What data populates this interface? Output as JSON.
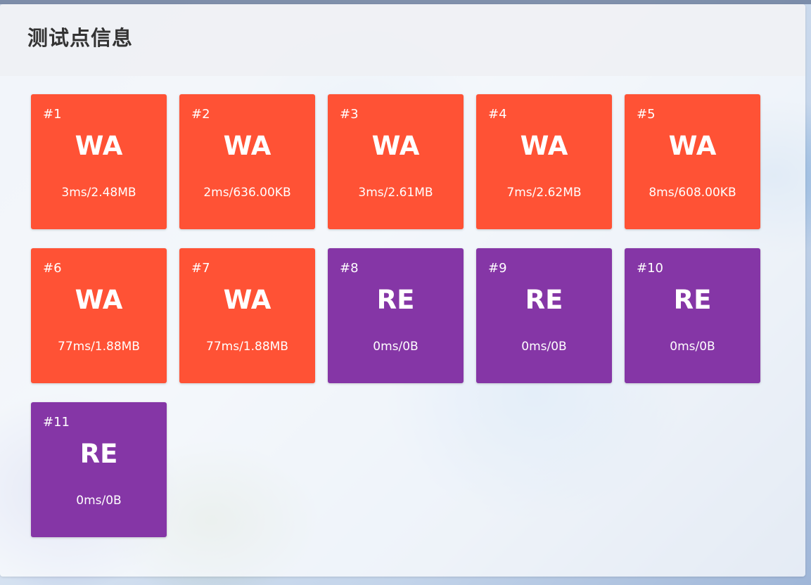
{
  "panel": {
    "title": "测试点信息"
  },
  "status_colors": {
    "WA": "#ff5235",
    "RE": "#8536a6"
  },
  "cases": [
    {
      "id": "#1",
      "status": "WA",
      "usage": "3ms/2.48MB"
    },
    {
      "id": "#2",
      "status": "WA",
      "usage": "2ms/636.00KB"
    },
    {
      "id": "#3",
      "status": "WA",
      "usage": "3ms/2.61MB"
    },
    {
      "id": "#4",
      "status": "WA",
      "usage": "7ms/2.62MB"
    },
    {
      "id": "#5",
      "status": "WA",
      "usage": "8ms/608.00KB"
    },
    {
      "id": "#6",
      "status": "WA",
      "usage": "77ms/1.88MB"
    },
    {
      "id": "#7",
      "status": "WA",
      "usage": "77ms/1.88MB"
    },
    {
      "id": "#8",
      "status": "RE",
      "usage": "0ms/0B"
    },
    {
      "id": "#9",
      "status": "RE",
      "usage": "0ms/0B"
    },
    {
      "id": "#10",
      "status": "RE",
      "usage": "0ms/0B"
    },
    {
      "id": "#11",
      "status": "RE",
      "usage": "0ms/0B"
    }
  ]
}
